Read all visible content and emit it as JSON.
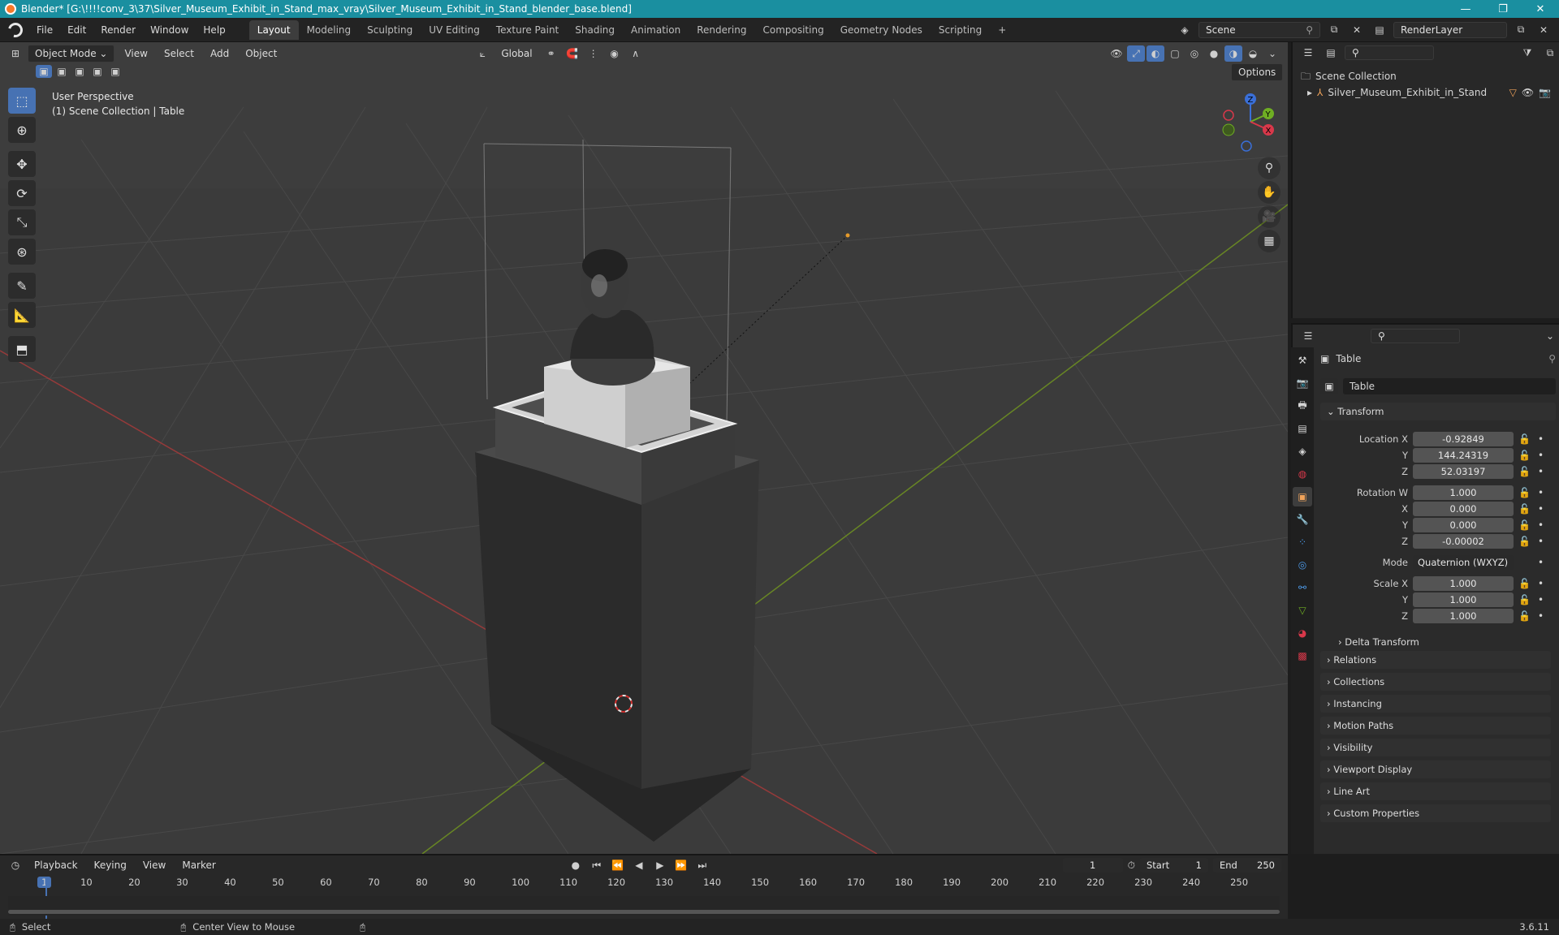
{
  "window": {
    "title": "Blender* [G:\\!!!!conv_3\\37\\Silver_Museum_Exhibit_in_Stand_max_vray\\Silver_Museum_Exhibit_in_Stand_blender_base.blend]",
    "minimize": "—",
    "maximize": "❐",
    "close": "✕"
  },
  "menu": {
    "file": "File",
    "edit": "Edit",
    "render": "Render",
    "window": "Window",
    "help": "Help"
  },
  "workspaces": [
    "Layout",
    "Modeling",
    "Sculpting",
    "UV Editing",
    "Texture Paint",
    "Shading",
    "Animation",
    "Rendering",
    "Compositing",
    "Geometry Nodes",
    "Scripting"
  ],
  "workspace_add": "+",
  "scene": {
    "name": "Scene",
    "render_layer": "RenderLayer"
  },
  "viewport": {
    "mode": "Object Mode",
    "menus": {
      "view": "View",
      "select": "Select",
      "add": "Add",
      "object": "Object"
    },
    "orientation": "Global",
    "options": "Options",
    "overlay_line1": "User Perspective",
    "overlay_line2": "(1) Scene Collection | Table",
    "gizmo": {
      "x": "X",
      "y": "Y",
      "z": "Z"
    }
  },
  "outliner": {
    "root": "Scene Collection",
    "item": "Silver_Museum_Exhibit_in_Stand"
  },
  "properties": {
    "object_name": "Table",
    "data_name": "Table",
    "transform_label": "Transform",
    "location": {
      "label": "Location X",
      "x": "-0.92849",
      "y": "144.24319",
      "z": "52.03197"
    },
    "rotation": {
      "label": "Rotation W",
      "w": "1.000",
      "x": "0.000",
      "y": "0.000",
      "z": "-0.00002"
    },
    "mode_label": "Mode",
    "mode_value": "Quaternion (WXYZ)",
    "scale": {
      "label": "Scale X",
      "x": "1.000",
      "y": "1.000",
      "z": "1.000"
    },
    "axis_y": "Y",
    "axis_z": "Z",
    "axis_x": "X",
    "delta_transform": "Delta Transform",
    "panels": [
      "Relations",
      "Collections",
      "Instancing",
      "Motion Paths",
      "Visibility",
      "Viewport Display",
      "Line Art",
      "Custom Properties"
    ]
  },
  "timeline": {
    "menus": {
      "playback": "Playback",
      "keying": "Keying",
      "view": "View",
      "marker": "Marker"
    },
    "current_frame": "1",
    "start_label": "Start",
    "start": "1",
    "end_label": "End",
    "end": "250",
    "ruler": [
      "1",
      "10",
      "20",
      "30",
      "40",
      "50",
      "60",
      "70",
      "80",
      "90",
      "100",
      "110",
      "120",
      "130",
      "140",
      "150",
      "160",
      "170",
      "180",
      "190",
      "200",
      "210",
      "220",
      "230",
      "240",
      "250"
    ]
  },
  "status": {
    "select": "Select",
    "center_view": "Center View to Mouse",
    "version": "3.6.11"
  },
  "colors": {
    "accent": "#4772b3",
    "titlebar": "#1a8fa0",
    "grid_x": "#9a3a3a",
    "grid_y": "#6c8a2a"
  }
}
